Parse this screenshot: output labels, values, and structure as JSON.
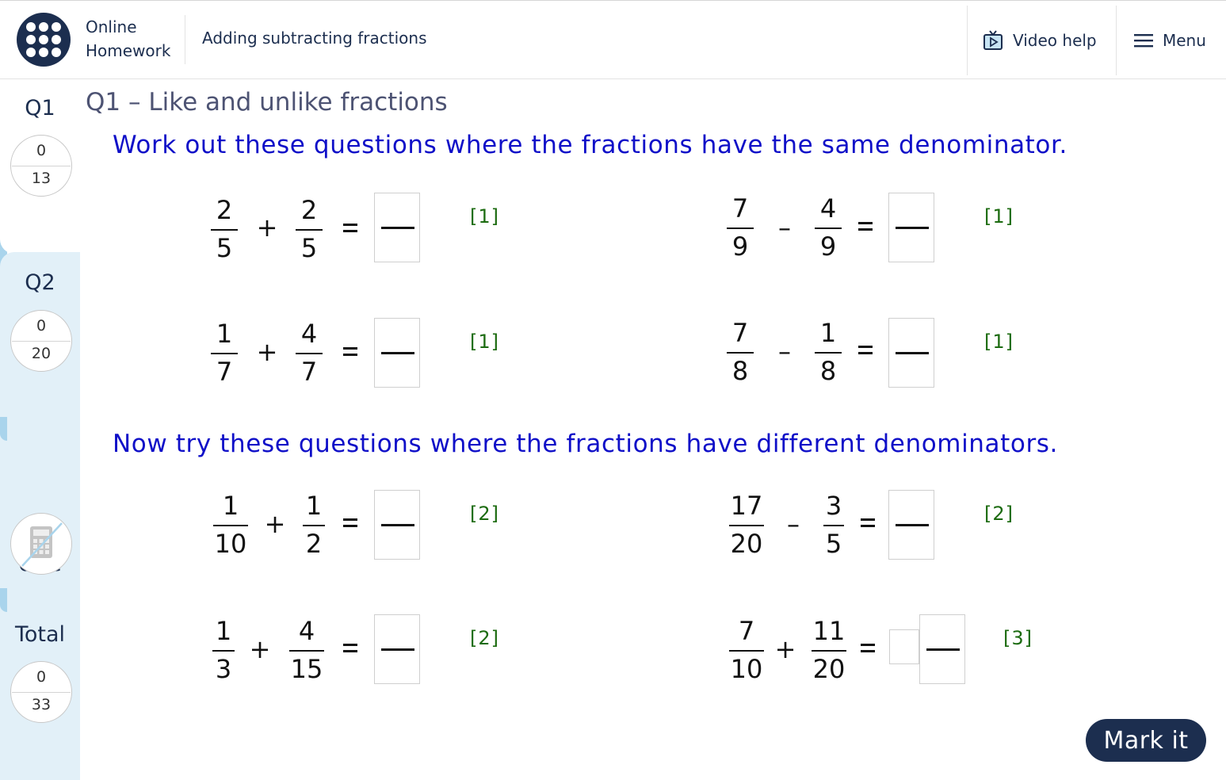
{
  "header": {
    "brand_line1": "Online",
    "brand_line2": "Homework",
    "topic": "Adding subtracting fractions",
    "video_help": "Video help",
    "menu": "Menu"
  },
  "sidebar": {
    "q1": {
      "label": "Q1",
      "score": "0",
      "total": "13"
    },
    "q2": {
      "label": "Q2",
      "score": "0",
      "total": "20"
    },
    "nocalc": {
      "line1": "No",
      "line2": "calc"
    },
    "total": {
      "label": "Total",
      "score": "0",
      "total": "33"
    }
  },
  "main": {
    "title": "Q1 – Like and unlike fractions",
    "instruction1": "Work out these questions where the fractions have the same denominator.",
    "instruction2": "Now try these questions where the fractions have different denominators.",
    "questions": [
      {
        "a_num": "2",
        "a_den": "5",
        "op": "+",
        "b_num": "2",
        "b_den": "5",
        "eq": "=",
        "marks": "[1]"
      },
      {
        "a_num": "7",
        "a_den": "9",
        "op": "–",
        "b_num": "4",
        "b_den": "9",
        "eq": "=",
        "marks": "[1]"
      },
      {
        "a_num": "1",
        "a_den": "7",
        "op": "+",
        "b_num": "4",
        "b_den": "7",
        "eq": "=",
        "marks": "[1]"
      },
      {
        "a_num": "7",
        "a_den": "8",
        "op": "–",
        "b_num": "1",
        "b_den": "8",
        "eq": "=",
        "marks": "[1]"
      },
      {
        "a_num": "1",
        "a_den": "10",
        "op": "+",
        "b_num": "1",
        "b_den": "2",
        "eq": "=",
        "marks": "[2]"
      },
      {
        "a_num": "17",
        "a_den": "20",
        "op": "–",
        "b_num": "3",
        "b_den": "5",
        "eq": "=",
        "marks": "[2]"
      },
      {
        "a_num": "1",
        "a_den": "3",
        "op": "+",
        "b_num": "4",
        "b_den": "15",
        "eq": "=",
        "marks": "[2]"
      },
      {
        "a_num": "7",
        "a_den": "10",
        "op": "+",
        "b_num": "11",
        "b_den": "20",
        "eq": "=",
        "marks": "[3]"
      }
    ],
    "mark_button": "Mark it"
  },
  "colors": {
    "navy": "#1c2e4f",
    "instruction_blue": "#0f0fc8",
    "marks_green": "#1c6b10",
    "sidebar_bg": "#e2f0f8"
  },
  "icons": {
    "logo": "dot-grid-logo-icon",
    "video": "tv-play-icon",
    "menu": "hamburger-icon",
    "calculator": "crossed-calculator-icon"
  }
}
